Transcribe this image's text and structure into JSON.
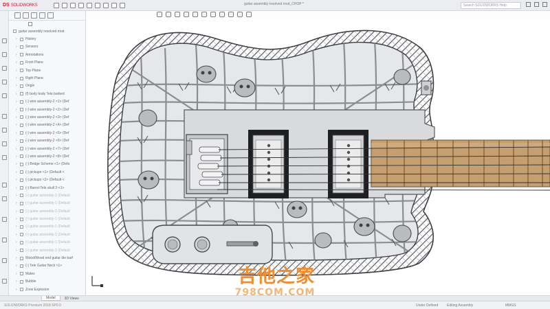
{
  "titlebar": {
    "brand_mark": "DS",
    "brand_name": "SOLIDWORKS",
    "document_title": "guitar assembly resolved mod_CHOP *",
    "search_placeholder": "Search SOLIDWORKS Help"
  },
  "tree": {
    "root": "guitar assembly resolved mod",
    "items": [
      {
        "label": "History",
        "blurred": false
      },
      {
        "label": "Sensors",
        "blurred": false
      },
      {
        "label": "Annotations",
        "blurred": false
      },
      {
        "label": "Front Plane",
        "blurred": false
      },
      {
        "label": "Top Plane",
        "blurred": false
      },
      {
        "label": "Right Plane",
        "blurred": false
      },
      {
        "label": "Origin",
        "blurred": false
      },
      {
        "label": "(f) body body Tele barbed",
        "blurred": false
      },
      {
        "label": "(-) wire assembly-2 <1> (Def",
        "blurred": false
      },
      {
        "label": "(-) wire assembly-2 <2> (Def",
        "blurred": false
      },
      {
        "label": "(-) wire assembly-2 <3> (Def",
        "blurred": false
      },
      {
        "label": "(-) wire assembly-2 <4> (Def",
        "blurred": false
      },
      {
        "label": "(-) wire assembly-2 <5> (Def",
        "blurred": false
      },
      {
        "label": "(-) wire assembly-2 <6> (Def",
        "blurred": false
      },
      {
        "label": "(-) wire assembly-2 <7> (Def",
        "blurred": false
      },
      {
        "label": "(-) wire assembly-2 <8> (Def",
        "blurred": false
      },
      {
        "label": "(-) Bridge Scheme <1> (Defa",
        "blurred": false
      },
      {
        "label": "(-) pickups <1> (Default <",
        "blurred": false
      },
      {
        "label": "(-) pickups <2> (Default <",
        "blurred": false
      },
      {
        "label": "(-) Barrel-Tele skull 2-<1>",
        "blurred": false
      },
      {
        "label": "(-) guitar assembly-1 (Default",
        "blurred": true
      },
      {
        "label": "(-) guitar assembly-1 (Default",
        "blurred": true
      },
      {
        "label": "(-) guitar assembly-1 (Default",
        "blurred": true
      },
      {
        "label": "(-) guitar assembly-1 (Default",
        "blurred": true
      },
      {
        "label": "(-) guitar assembly-1 (Default",
        "blurred": true
      },
      {
        "label": "(-) guitar assembly-1 (Default",
        "blurred": true
      },
      {
        "label": "(-) guitar assembly-1 (Default",
        "blurred": true
      },
      {
        "label": "(-) guitar assembly-1 (Default",
        "blurred": true
      },
      {
        "label": "Wood/Wood end guitar die barf",
        "blurred": false
      },
      {
        "label": "(-) Tele Guitar Neck <1>",
        "blurred": false
      },
      {
        "label": "Mates",
        "blurred": false
      },
      {
        "label": "Bubble",
        "blurred": false
      },
      {
        "label": "Zone Explosion",
        "blurred": false
      }
    ]
  },
  "bottom_tabs": [
    {
      "label": "Model",
      "active": true
    },
    {
      "label": "3D Views",
      "active": false
    }
  ],
  "status": {
    "left": "SOLIDWORKS Premium 2018 SP0.0",
    "mid": "Under Defined",
    "mid2": "Editing Assembly",
    "right": "MMGS"
  },
  "watermark": {
    "chinese": "吉他之家",
    "url": "798COM.COM"
  },
  "colors": {
    "brand_red": "#c8202f",
    "body_gray": "#8e9196",
    "pickguard": "#d9dadc",
    "fretboard": "#c59f6f",
    "watermark_orange": "#ef8d32"
  }
}
